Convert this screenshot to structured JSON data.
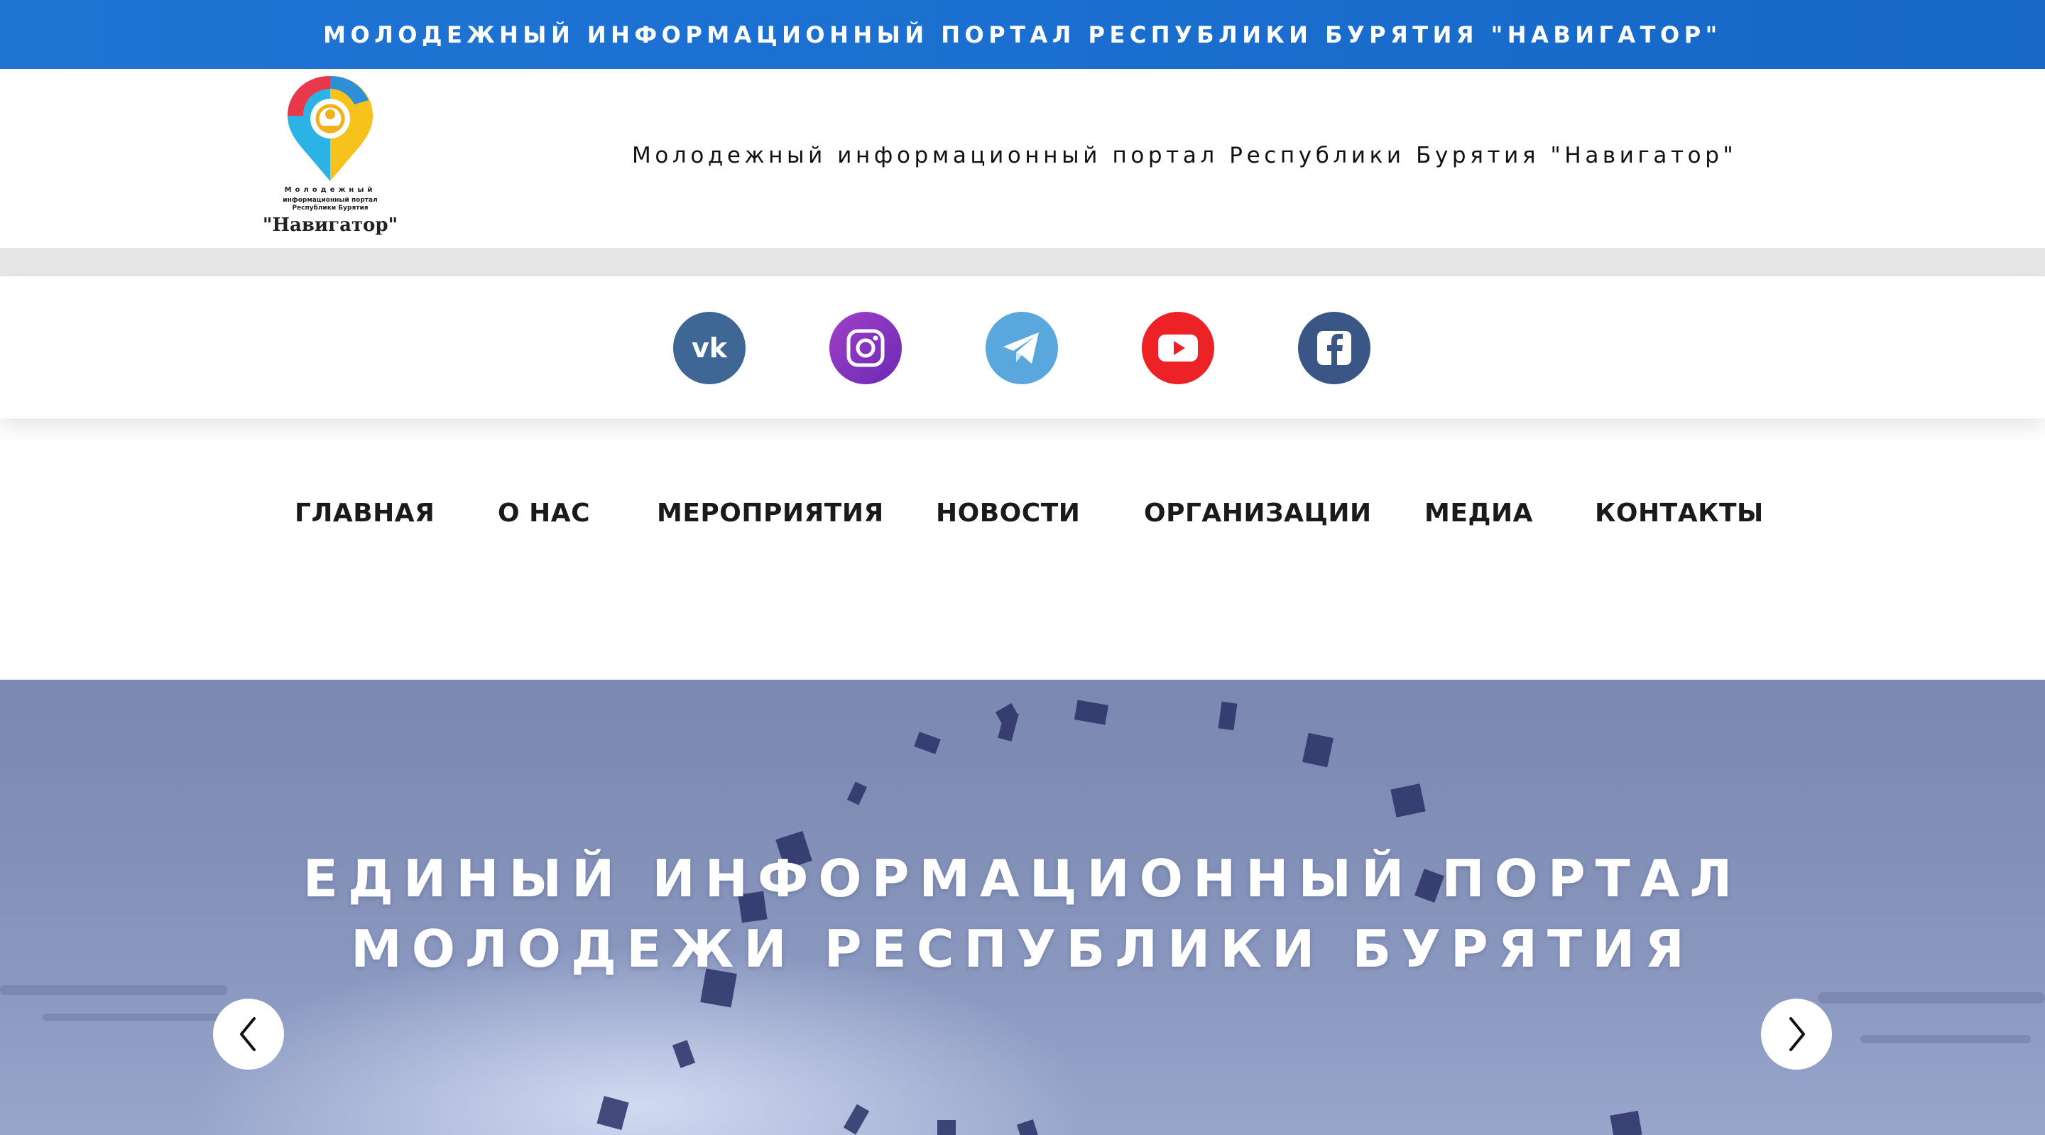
{
  "topbar": {
    "title": "МОЛОДЕЖНЫЙ ИНФОРМАЦИОННЫЙ ПОРТАЛ РЕСПУБЛИКИ БУРЯТИЯ \"НАВИГАТОР\""
  },
  "header": {
    "logo": {
      "line1": "Молодежный",
      "line2": "информационный портал",
      "line3": "Республики Бурятия",
      "line4": "\"Навигатор\""
    },
    "title": "Молодежный информационный портал Республики Бурятия \"Навигатор\""
  },
  "social": {
    "icons": [
      "vk-icon",
      "instagram-icon",
      "telegram-icon",
      "youtube-icon",
      "facebook-icon"
    ]
  },
  "nav": {
    "items": [
      {
        "label": "ГЛАВНАЯ"
      },
      {
        "label": "О НАС"
      },
      {
        "label": "МЕРОПРИЯТИЯ"
      },
      {
        "label": "НОВОСТИ"
      },
      {
        "label": "ОРГАНИЗАЦИИ"
      },
      {
        "label": "МЕДИА"
      },
      {
        "label": "КОНТАКТЫ"
      }
    ]
  },
  "hero": {
    "line1": "ЕДИНЫЙ ИНФОРМАЦИОННЫЙ ПОРТАЛ",
    "line2": "МОЛОДЕЖИ РЕСПУБЛИКИ БУРЯТИЯ",
    "prev_icon": "chevron-left-icon",
    "next_icon": "chevron-right-icon"
  },
  "colors": {
    "topbar": "#1b6fd0",
    "vk": "#3e6796",
    "instagram": "#8a35be",
    "telegram": "#59a7dd",
    "youtube": "#ec2227",
    "facebook": "#3a5687"
  }
}
